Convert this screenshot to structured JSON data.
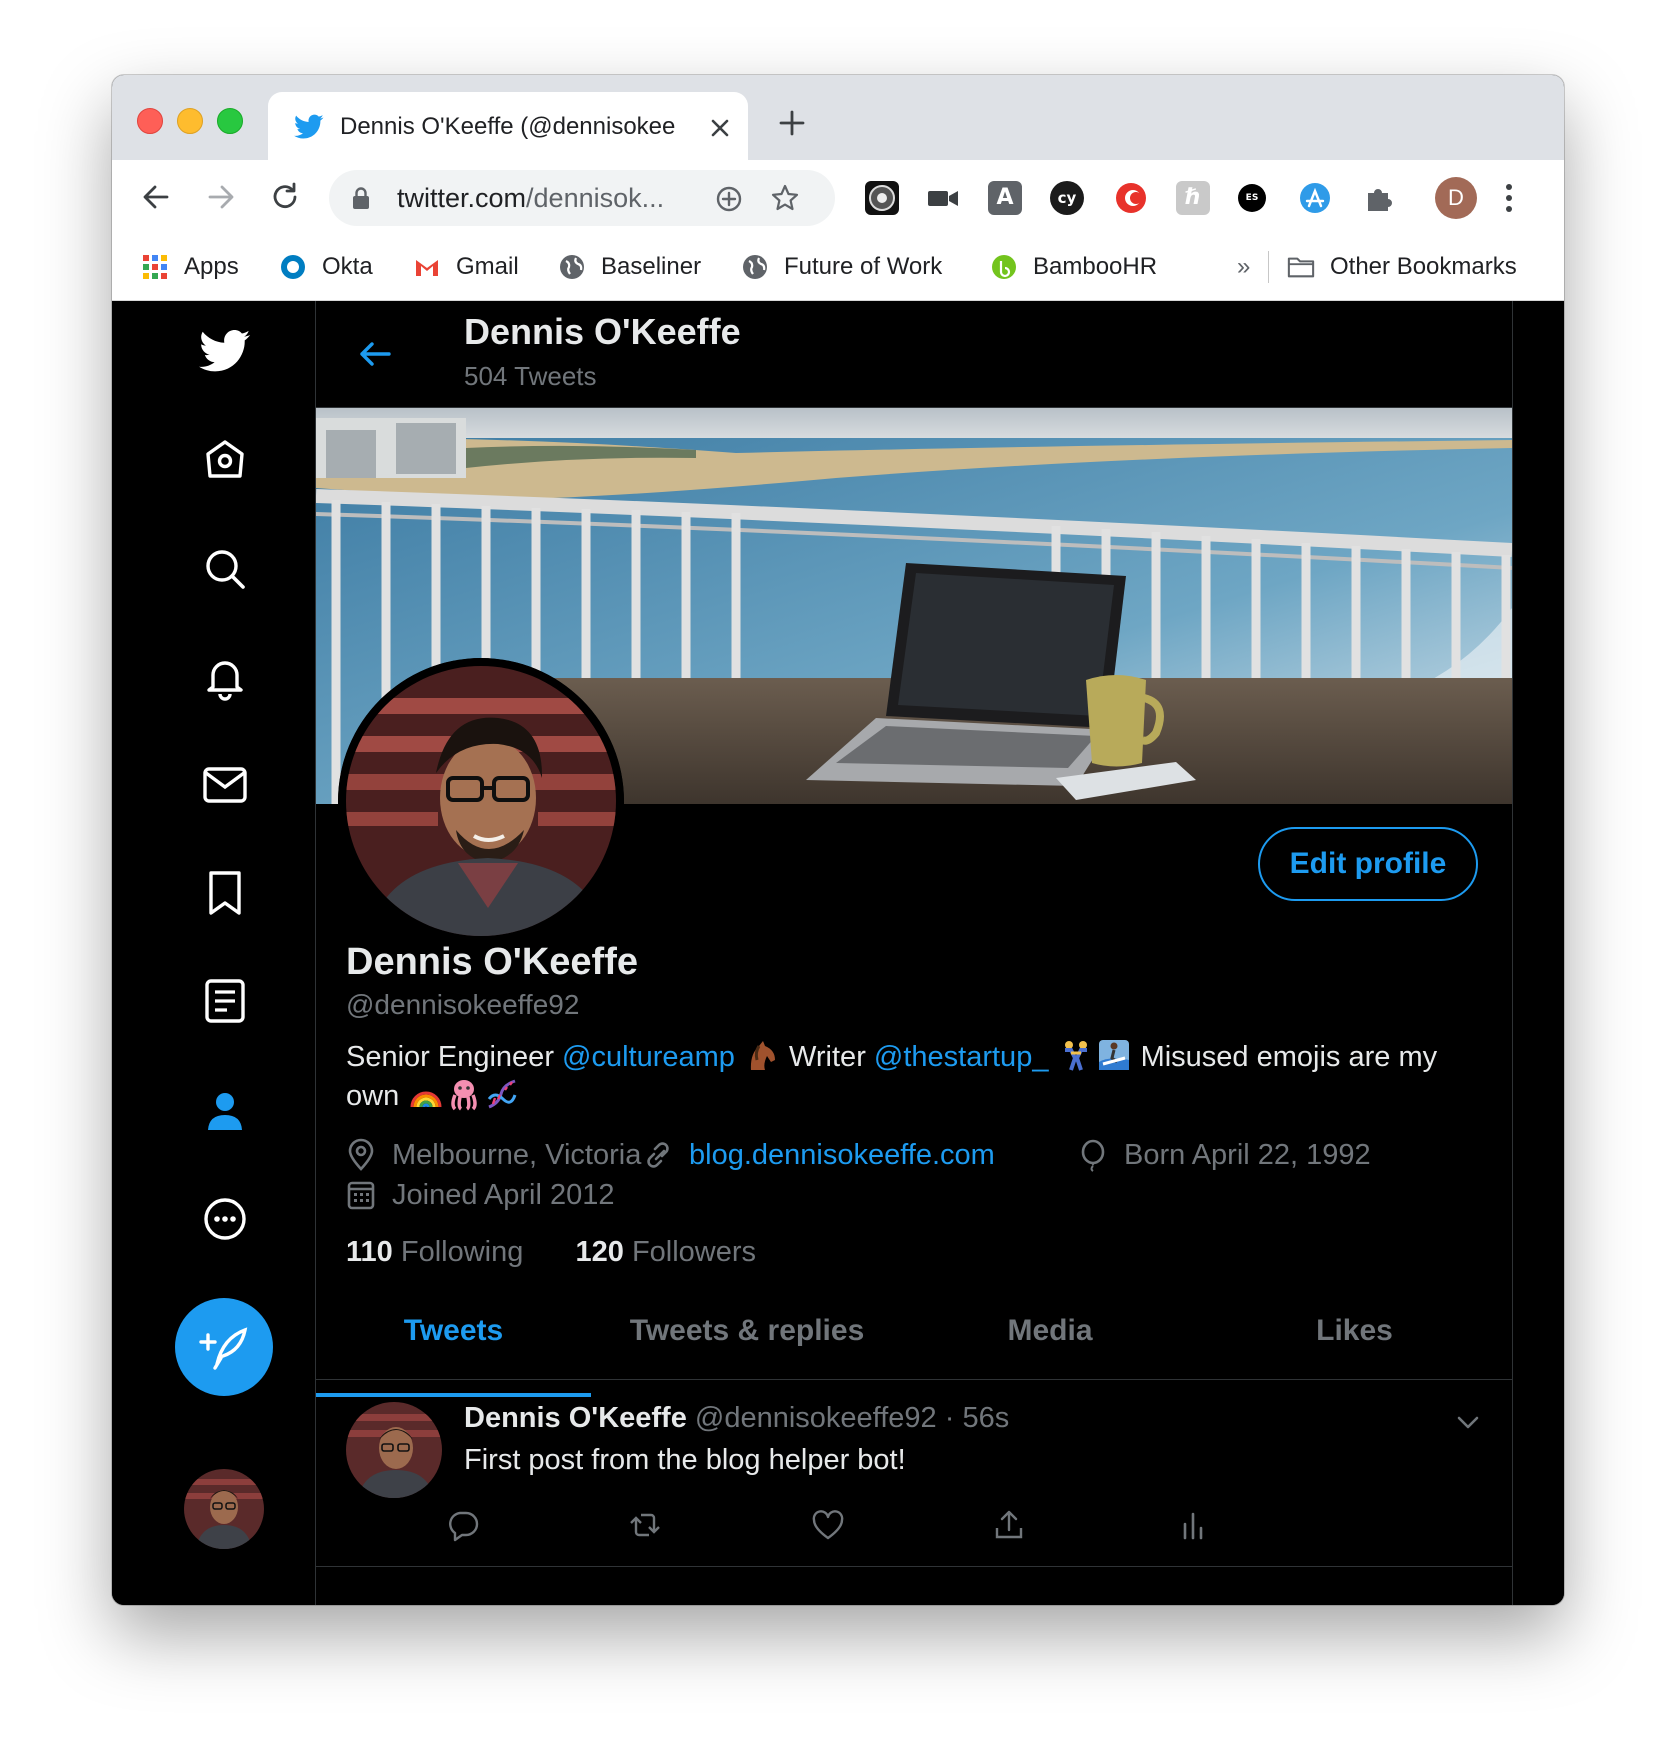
{
  "browser": {
    "tab_title": "Dennis O'Keeffe (@dennisokee",
    "url_domain": "twitter.com",
    "url_path": "/dennisok...",
    "profile_initial": "D",
    "extension_icons": [
      "obs-icon",
      "video-camera-icon",
      "font-a-icon",
      "cy-icon",
      "c-red-icon",
      "k-gray-icon",
      "es-icon",
      "app-store-icon",
      "puzzle-icon"
    ],
    "bookmarks": [
      {
        "label": "Apps",
        "icon": "apps-grid-icon"
      },
      {
        "label": "Okta",
        "icon": "okta-icon"
      },
      {
        "label": "Gmail",
        "icon": "gmail-icon"
      },
      {
        "label": "Baseliner",
        "icon": "globe-icon"
      },
      {
        "label": "Future of Work",
        "icon": "globe-icon"
      },
      {
        "label": "BambooHR",
        "icon": "bamboohr-icon"
      }
    ],
    "bookmarks_overflow": "»",
    "other_bookmarks": "Other Bookmarks"
  },
  "twitter": {
    "accent": "#1d9bf0",
    "sidebar": [
      "twitter-logo-icon",
      "home-icon",
      "explore-icon",
      "notifications-icon",
      "messages-icon",
      "bookmarks-icon",
      "lists-icon",
      "profile-icon",
      "more-icon"
    ],
    "header": {
      "name": "Dennis O'Keeffe",
      "tweet_count": "504 Tweets"
    },
    "profile": {
      "edit_button": "Edit profile",
      "name": "Dennis O'Keeffe",
      "handle": "@dennisokeeffe92",
      "bio": {
        "part1": "Senior Engineer ",
        "mention1": "@cultureamp",
        "part2": " Writer ",
        "mention2": "@thestartup_",
        "part3": " Misused emojis are my own"
      },
      "location": "Melbourne, Victoria",
      "website": "blog.dennisokeeffe.com",
      "birthday": "Born April 22, 1992",
      "joined": "Joined April 2012",
      "following_count": "110",
      "following_label": "Following",
      "followers_count": "120",
      "followers_label": "Followers"
    },
    "tabs": [
      "Tweets",
      "Tweets & replies",
      "Media",
      "Likes"
    ],
    "active_tab": "Tweets",
    "tweet": {
      "name": "Dennis O'Keeffe",
      "handle": "@dennisokeeffe92",
      "separator": "·",
      "time": "56s",
      "text": "First post from the blog helper bot!"
    }
  }
}
